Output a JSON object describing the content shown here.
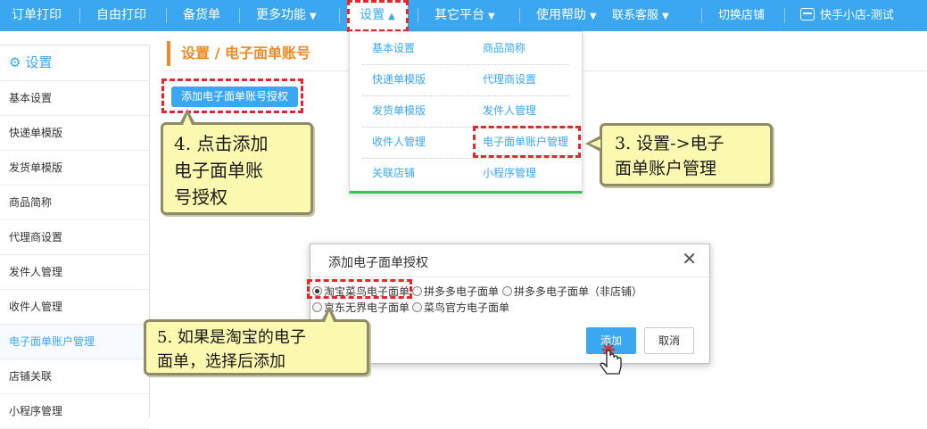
{
  "topnav": {
    "items": [
      {
        "label": "订单打印"
      },
      {
        "label": "自由打印"
      },
      {
        "label": "备货单"
      },
      {
        "label": "更多功能"
      },
      {
        "label": "设置"
      },
      {
        "label": "其它平台"
      },
      {
        "label": "使用帮助"
      },
      {
        "label": "联系客服"
      },
      {
        "label": "切换店铺"
      },
      {
        "label": "快手小店-测试"
      }
    ]
  },
  "sidebar": {
    "title": "设置",
    "items": [
      {
        "label": "基本设置"
      },
      {
        "label": "快递单模版"
      },
      {
        "label": "发货单模版"
      },
      {
        "label": "商品简称"
      },
      {
        "label": "代理商设置"
      },
      {
        "label": "发件人管理"
      },
      {
        "label": "收件人管理"
      },
      {
        "label": "电子面单账户管理"
      },
      {
        "label": "店铺关联"
      },
      {
        "label": "小程序管理"
      }
    ]
  },
  "main": {
    "breadcrumb": "设置 / 电子面单账号",
    "add_button": "添加电子面单账号授权"
  },
  "dropdown": {
    "items": [
      {
        "label": "基本设置"
      },
      {
        "label": "商品简称"
      },
      {
        "label": "快递单模版"
      },
      {
        "label": "代理商设置"
      },
      {
        "label": "发货单模版"
      },
      {
        "label": "发件人管理"
      },
      {
        "label": "收件人管理"
      },
      {
        "label": "电子面单账户管理"
      },
      {
        "label": "关联店铺"
      },
      {
        "label": "小程序管理"
      }
    ]
  },
  "callouts": {
    "step3": "3. 设置->电子\n面单账户管理",
    "step4": "4. 点击添加\n电子面单账\n号授权",
    "step5": "5. 如果是淘宝的电子\n面单，选择后添加"
  },
  "modal": {
    "title": "添加电子面单授权",
    "close": "✕",
    "options": [
      {
        "label": "淘宝菜鸟电子面单",
        "checked": true
      },
      {
        "label": "拼多多电子面单",
        "checked": false
      },
      {
        "label": "拼多多电子面单（非店铺）",
        "checked": false
      },
      {
        "label": "京东无界电子面单",
        "checked": false
      },
      {
        "label": "菜鸟官方电子面单",
        "checked": false
      }
    ],
    "add_label": "添加",
    "cancel_label": "取消"
  },
  "colors": {
    "nav_bg": "#3aa7f0",
    "accent_orange": "#f08a24",
    "highlight_red": "#e8262a",
    "callout_bg": "#fbf8b0"
  }
}
